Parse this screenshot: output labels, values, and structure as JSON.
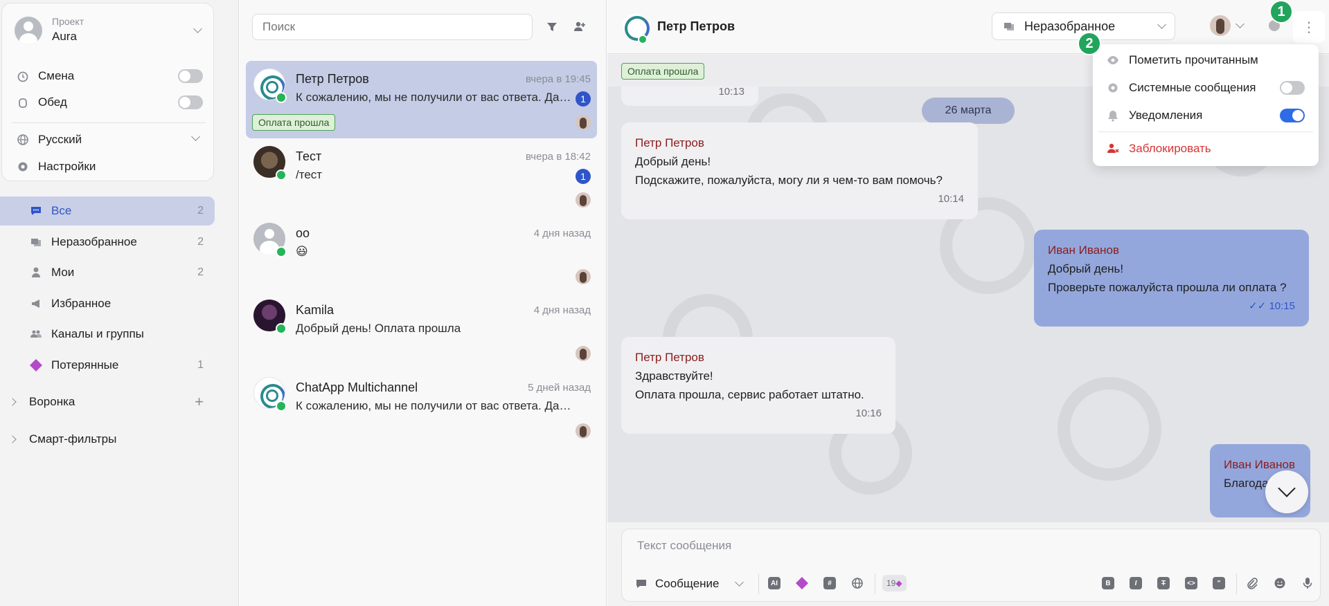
{
  "sidebar": {
    "project_label": "Проект",
    "project_name": "Aura",
    "toggles": [
      {
        "label": "Смена",
        "on": false
      },
      {
        "label": "Обед",
        "on": false
      }
    ],
    "language": "Русский",
    "settings": "Настройки",
    "nav": [
      {
        "label": "Все",
        "count": "2",
        "icon": "chat-bubble-icon",
        "active": true
      },
      {
        "label": "Неразобранное",
        "count": "2",
        "icon": "unsorted-icon"
      },
      {
        "label": "Мои",
        "count": "2",
        "icon": "person-icon"
      },
      {
        "label": "Избранное",
        "count": "",
        "icon": "megaphone-icon"
      },
      {
        "label": "Каналы и группы",
        "count": "",
        "icon": "group-icon"
      },
      {
        "label": "Потерянные",
        "count": "1",
        "icon": "diamond-icon"
      }
    ],
    "groups": [
      {
        "label": "Воронка"
      },
      {
        "label": "Смарт-фильтры"
      }
    ]
  },
  "list": {
    "search_placeholder": "Поиск",
    "conversations": [
      {
        "name": "Петр Петров",
        "time": "вчера в 19:45",
        "preview": "К сожалению, мы не получили от вас ответа. Дайте знать, если понадобится помощь.",
        "badge": "1",
        "tag": "Оплата прошла",
        "avatar": "aura",
        "selected": true
      },
      {
        "name": "Тест",
        "time": "вчера в 18:42",
        "preview": "/тест",
        "badge": "1",
        "avatar": "photo1"
      },
      {
        "name": "oo",
        "time": "4 дня назад",
        "preview": "😃",
        "avatar": "gray"
      },
      {
        "name": "Kamila",
        "time": "4 дня назад",
        "preview": "Добрый день! Оплата прошла",
        "avatar": "photo2"
      },
      {
        "name": "ChatApp Multichannel",
        "time": "5 дней назад",
        "preview": "К сожалению, мы не получили от вас ответа. Дайте знать, если понадобится помощь.",
        "avatar": "aura"
      }
    ]
  },
  "chat": {
    "contact_name": "Петр Петров",
    "status": "Неразобранное",
    "tag": "Оплата прошла",
    "prev_time": "10:13",
    "date_divider": "26 марта",
    "messages": [
      {
        "dir": "in",
        "sender": "Петр Петров",
        "lines": [
          "Добрый день!",
          "Подскажите, пожалуйста, могу ли я чем-то вам помочь?"
        ],
        "time": "10:14"
      },
      {
        "dir": "out",
        "sender": "Иван Иванов",
        "lines": [
          "Добрый день!",
          "Проверьте пожалуйста прошла ли оплата ?"
        ],
        "time": "10:15"
      },
      {
        "dir": "in",
        "sender": "Петр Петров",
        "lines": [
          "Здравствуйте!",
          "Оплата прошла, сервис работает штатно."
        ],
        "time": "10:16"
      },
      {
        "dir": "out",
        "sender": "Иван Иванов",
        "lines": [
          "Благода"
        ],
        "time": ""
      }
    ],
    "composer": {
      "placeholder": "Текст сообщения",
      "type": "Сообщение",
      "credits": "19"
    }
  },
  "menu": {
    "items": [
      {
        "label": "Пометить прочитанным",
        "icon": "eye-icon"
      },
      {
        "label": "Системные сообщения",
        "icon": "gear-icon",
        "toggle": false
      },
      {
        "label": "Уведомления",
        "icon": "bell-icon",
        "toggle": true
      },
      {
        "label": "Заблокировать",
        "icon": "block-user-icon",
        "danger": true
      }
    ]
  },
  "markers": [
    "1",
    "2"
  ],
  "colors": {
    "accent": "#2f55c8",
    "selected_row": "#c4cce6",
    "outgoing_bubble": "#94a7dc",
    "tag_green": "#4fa356",
    "danger": "#d43535",
    "marker_green": "#22a45d"
  }
}
